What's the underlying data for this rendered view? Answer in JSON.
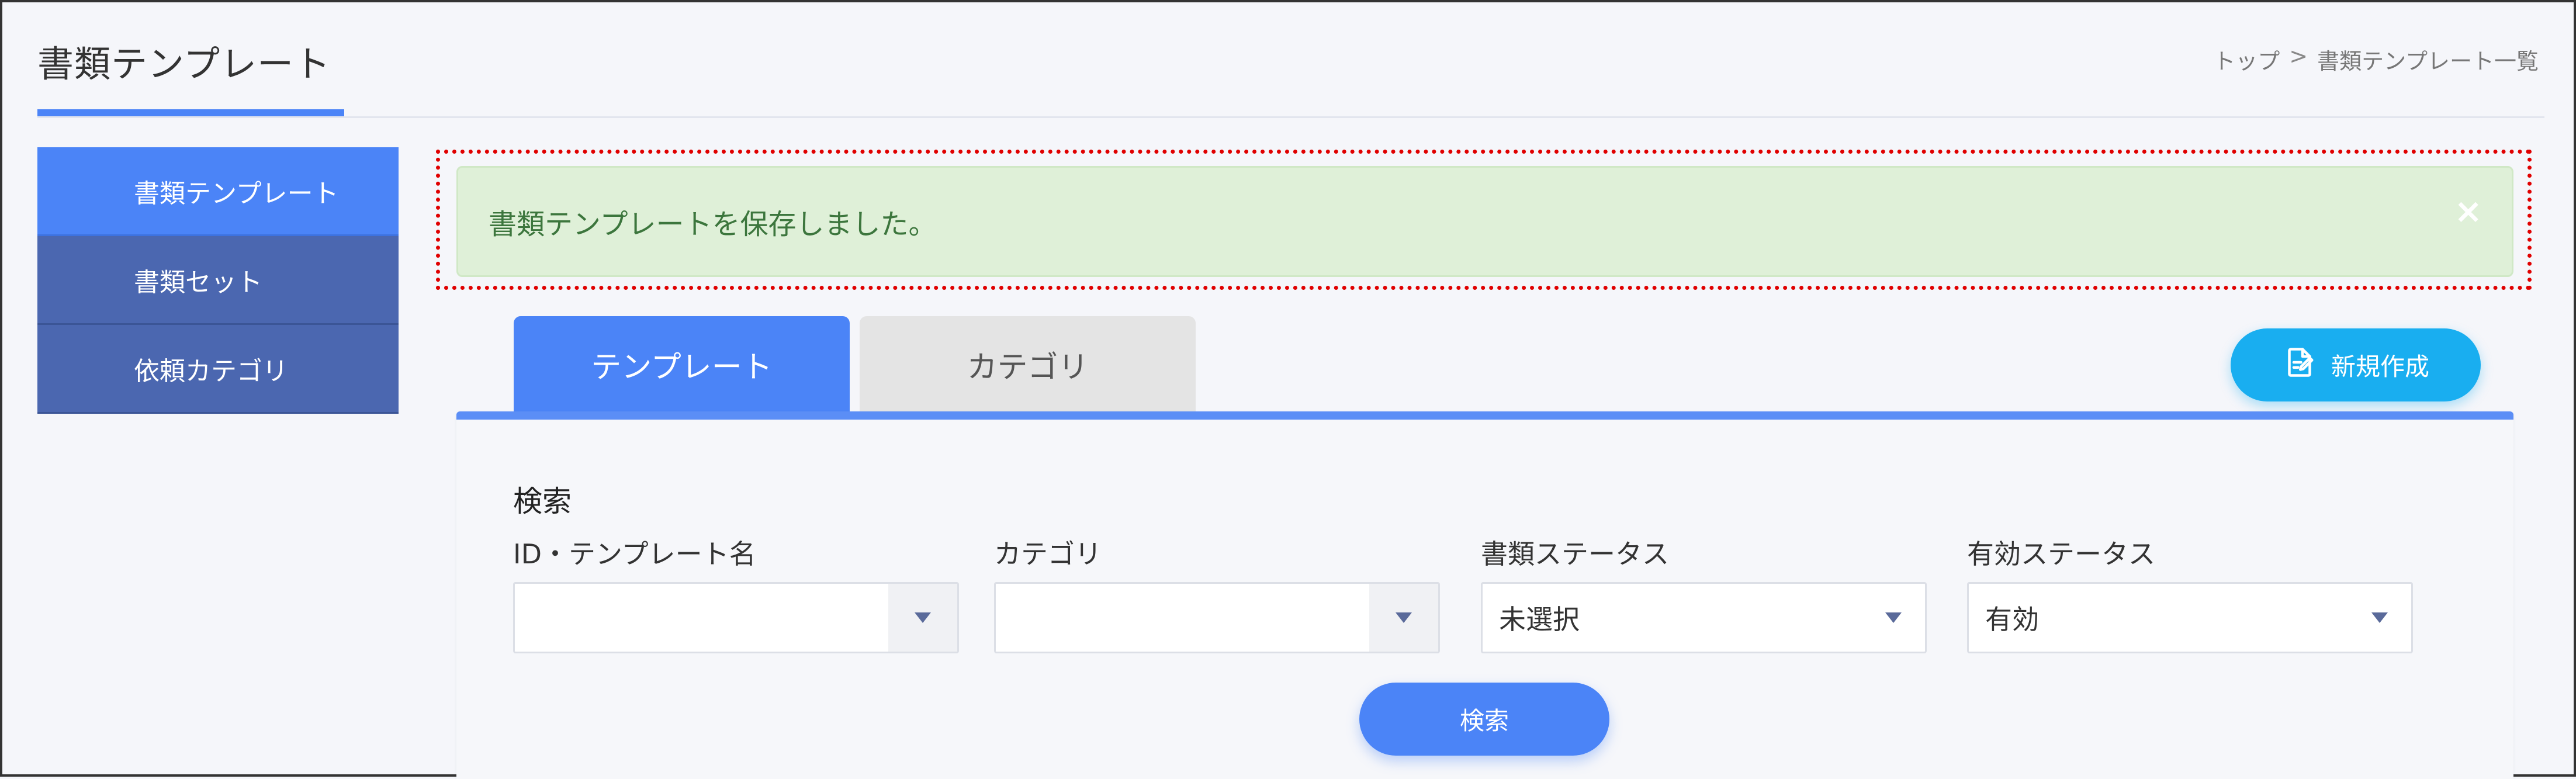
{
  "header": {
    "title": "書類テンプレート",
    "breadcrumb": [
      "トップ",
      "書類テンプレート一覧"
    ],
    "breadcrumb_separator": ">"
  },
  "sidebar": {
    "items": [
      {
        "label": "書類テンプレート",
        "active": true
      },
      {
        "label": "書類セット",
        "active": false
      },
      {
        "label": "依頼カテゴリ",
        "active": false
      }
    ]
  },
  "alert": {
    "message": "書類テンプレートを保存しました。",
    "close_glyph": "×"
  },
  "tabs": [
    {
      "label": "テンプレート",
      "active": true
    },
    {
      "label": "カテゴリ",
      "active": false
    }
  ],
  "actions": {
    "new_label": "新規作成",
    "new_icon": "edit-document-icon"
  },
  "search": {
    "heading": "検索",
    "fields": [
      {
        "label": "ID・テンプレート名",
        "value": ""
      },
      {
        "label": "カテゴリ",
        "value": ""
      },
      {
        "label": "書類ステータス",
        "value": "未選択"
      },
      {
        "label": "有効ステータス",
        "value": "有効"
      }
    ],
    "button_label": "検索"
  },
  "colors": {
    "accent": "#4b84f7",
    "sidebar": "#4b67b0",
    "alert_bg": "#dff0d8",
    "alert_text": "#3c763d",
    "new_button": "#19aef0",
    "highlight": "#e00000"
  }
}
